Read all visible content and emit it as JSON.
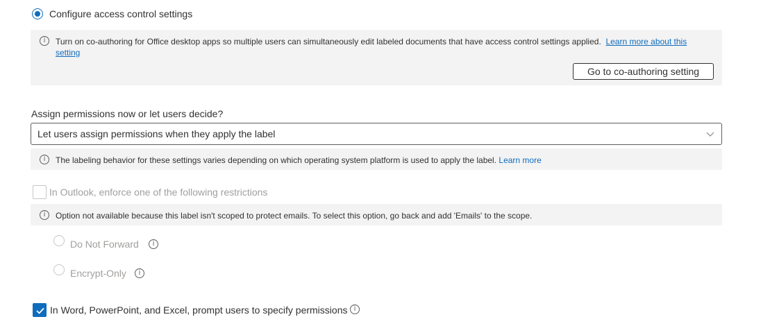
{
  "access_control": {
    "option_label": "Configure access control settings",
    "coauthoring_note": "Turn on co-authoring for Office desktop apps so multiple users can simultaneously edit labeled documents that have access control settings applied.",
    "coauthoring_link": "Learn more about this setting",
    "coauthoring_button": "Go to co-authoring setting"
  },
  "permissions": {
    "question": "Assign permissions now or let users decide?",
    "selected": "Let users assign permissions when they apply the label",
    "note": "The labeling behavior for these settings varies depending on which operating system platform is used to apply the label.",
    "note_link": "Learn more"
  },
  "outlook": {
    "label": "In Outlook, enforce one of the following restrictions",
    "note": "Option not available because this label isn't scoped to protect emails. To select this option, go back and add 'Emails' to the scope.",
    "options": [
      {
        "label": "Do Not Forward"
      },
      {
        "label": "Encrypt-Only"
      }
    ]
  },
  "office": {
    "label": "In Word, PowerPoint, and Excel, prompt users to specify permissions"
  },
  "icons": {
    "info": "info-icon",
    "chevron": "chevron-down-icon",
    "check": "check-icon"
  },
  "colors": {
    "accent": "#0f6cbd",
    "panel_bg": "#f3f3f3",
    "disabled_text": "#a19f9d"
  }
}
